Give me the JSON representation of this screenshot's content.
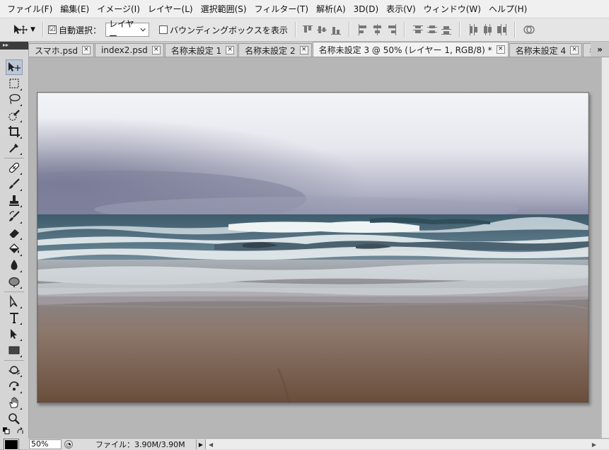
{
  "menu": [
    "ファイル(F)",
    "編集(E)",
    "イメージ(I)",
    "レイヤー(L)",
    "選択範囲(S)",
    "フィルター(T)",
    "解析(A)",
    "3D(D)",
    "表示(V)",
    "ウィンドウ(W)",
    "ヘルプ(H)"
  ],
  "options": {
    "auto_select_label": "自動選択：",
    "auto_select_checked": "☑",
    "layer_select_value": "レイヤー",
    "bbox_label": "バウンディングボックスを表示"
  },
  "tabs": [
    {
      "label": "スマホ.psd"
    },
    {
      "label": "index2.psd"
    },
    {
      "label": "名称未設定 1"
    },
    {
      "label": "名称未設定 2"
    },
    {
      "label": "名称未設定 3 @ 50% (レイヤー 1, RGB/8) *",
      "active": true
    },
    {
      "label": "名称未設定 4"
    },
    {
      "label": "名"
    }
  ],
  "tab_overflow": "»",
  "panel_grip": "▸▸",
  "tools": [
    "move-tool-icon",
    "marquee-tool-icon",
    "lasso-tool-icon",
    "quick-select-tool-icon",
    "crop-tool-icon",
    "eyedropper-tool-icon",
    "healing-brush-tool-icon",
    "brush-tool-icon",
    "clone-stamp-tool-icon",
    "history-brush-tool-icon",
    "eraser-tool-icon",
    "paint-bucket-tool-icon",
    "blur-tool-icon",
    "dodge-tool-icon",
    "path-select-tool-icon",
    "type-tool-icon",
    "direct-select-tool-icon",
    "rectangle-tool-icon",
    "3d-rotate-tool-icon",
    "3d-orbit-tool-icon",
    "hand-tool-icon",
    "zoom-tool-icon"
  ],
  "status": {
    "zoom": "50%",
    "file_info": "ファイル：3.90M/3.90M"
  },
  "colors": {
    "foreground": "#000000",
    "background": "#ffffff"
  }
}
